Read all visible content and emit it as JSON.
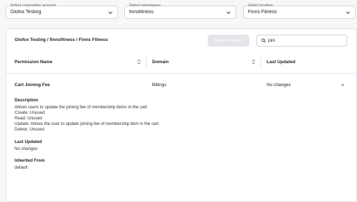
{
  "selectors": {
    "corporation": {
      "label": "Select corporation account",
      "value": "Glofox Testing"
    },
    "namespace": {
      "label": "Select namespace",
      "value": "finnsfitness"
    },
    "location": {
      "label": "Select location",
      "value": "Finns Fitness"
    }
  },
  "panel": {
    "breadcrumb": "Glofox Testing / finnsfitness / Finns Fitness",
    "save_label": "Save changes",
    "search_value": "join"
  },
  "table": {
    "columns": [
      "Permission Name",
      "Domain",
      "Last Updated"
    ],
    "rows": [
      {
        "name": "Cart Joining Fee",
        "domain": "Billings",
        "last_updated": "No changes",
        "expanded": true
      }
    ]
  },
  "details": {
    "description_heading": "Description",
    "description_lines": [
      "Allows users to update the joining fee of membership items in the cart",
      "Create: Unused",
      "Read: Unused",
      "Update: Allows the user to update joining fee of membership item in the cart",
      "Delete: Unused"
    ],
    "last_updated_heading": "Last Updated",
    "last_updated_value": "No changes",
    "inherited_heading": "Inherited From",
    "inherited_value": "default"
  },
  "icons": {
    "dropdown": "chevron-down-icon",
    "search": "search-icon",
    "sort": "sort-icon",
    "collapse": "chevron-up-icon"
  }
}
